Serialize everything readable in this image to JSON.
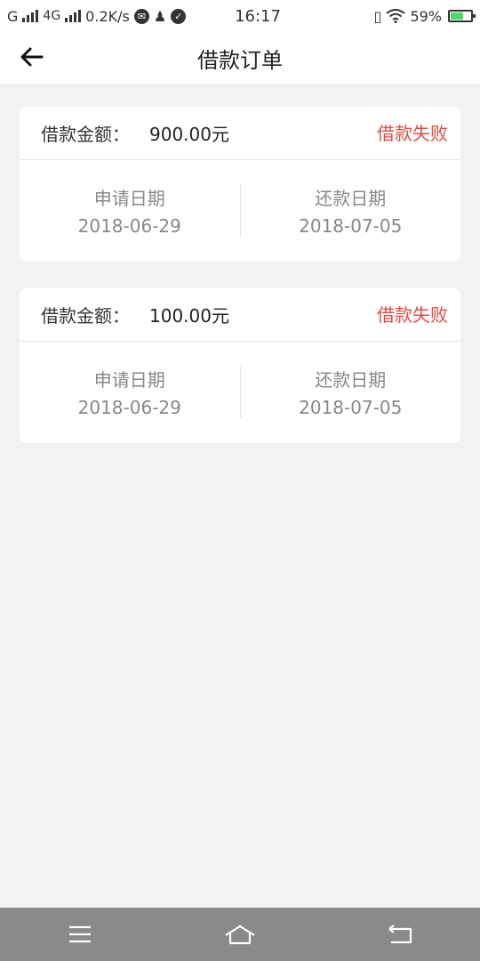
{
  "status_bar": {
    "carrier1": "G",
    "carrier2": "4G",
    "speed": "0.2K/s",
    "time": "16:17",
    "battery": "59%"
  },
  "header": {
    "title": "借款订单"
  },
  "orders": [
    {
      "amount_label": "借款金额：",
      "amount": "900.00元",
      "status": "借款失败",
      "apply_label": "申请日期",
      "apply_date": "2018-06-29",
      "repay_label": "还款日期",
      "repay_date": "2018-07-05"
    },
    {
      "amount_label": "借款金额：",
      "amount": "100.00元",
      "status": "借款失败",
      "apply_label": "申请日期",
      "apply_date": "2018-06-29",
      "repay_label": "还款日期",
      "repay_date": "2018-07-05"
    }
  ],
  "colors": {
    "accent": "#e04b3f",
    "background": "#f2f2f2",
    "navbar": "#8a8a8a"
  },
  "nav": {
    "icons": [
      "menu-icon",
      "home-icon",
      "back-icon"
    ]
  }
}
